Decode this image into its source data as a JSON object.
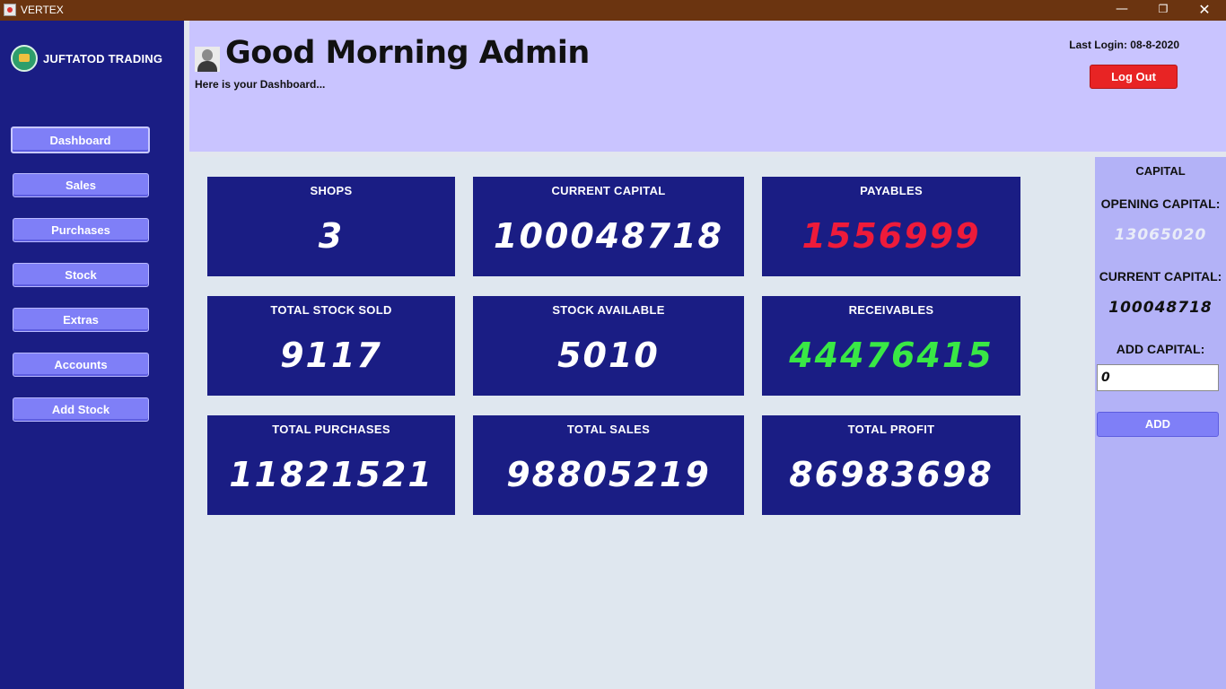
{
  "window": {
    "title": "VERTEX",
    "minimize_glyph": "—",
    "maximize_glyph": "❐",
    "close_glyph": "✕"
  },
  "sidebar": {
    "brand": "JUFTATOD TRADING",
    "items": [
      {
        "label": "Dashboard",
        "active": true
      },
      {
        "label": "Sales"
      },
      {
        "label": "Purchases"
      },
      {
        "label": "Stock"
      },
      {
        "label": "Extras"
      },
      {
        "label": "Accounts"
      },
      {
        "label": "Add Stock"
      }
    ]
  },
  "header": {
    "greeting": "Good Morning Admin",
    "subtitle": "Here is your Dashboard...",
    "last_login": "Last Login: 08-8-2020",
    "logout_label": "Log Out"
  },
  "cards": [
    {
      "label": "SHOPS",
      "value": "3",
      "color": "#ffffff"
    },
    {
      "label": "CURRENT CAPITAL",
      "value": "100048718",
      "color": "#ffffff"
    },
    {
      "label": "PAYABLES",
      "value": "1556999",
      "color": "#ee1b3a"
    },
    {
      "label": "TOTAL STOCK SOLD",
      "value": "9117",
      "color": "#ffffff"
    },
    {
      "label": "STOCK AVAILABLE",
      "value": "5010",
      "color": "#ffffff"
    },
    {
      "label": "RECEIVABLES",
      "value": "44476415",
      "color": "#39e845"
    },
    {
      "label": "TOTAL PURCHASES",
      "value": "11821521",
      "color": "#ffffff"
    },
    {
      "label": "TOTAL SALES",
      "value": "98805219",
      "color": "#ffffff"
    },
    {
      "label": "TOTAL PROFIT",
      "value": "86983698",
      "color": "#ffffff"
    }
  ],
  "capital_panel": {
    "title": "CAPITAL",
    "opening_label": "OPENING CAPITAL:",
    "opening_value": "13065020",
    "opening_color": "#e9ecf8",
    "current_label": "CURRENT CAPITAL:",
    "current_value": "100048718",
    "add_label": "ADD CAPITAL:",
    "add_input_value": "0",
    "add_button": "ADD"
  },
  "colors": {
    "sidebar_bg": "#1a1d84",
    "header_bg": "#c9c4ff",
    "card_bg": "#1a1d84",
    "button": "#7f7ff7",
    "logout": "#e82424",
    "titlebar": "#6b3410"
  }
}
